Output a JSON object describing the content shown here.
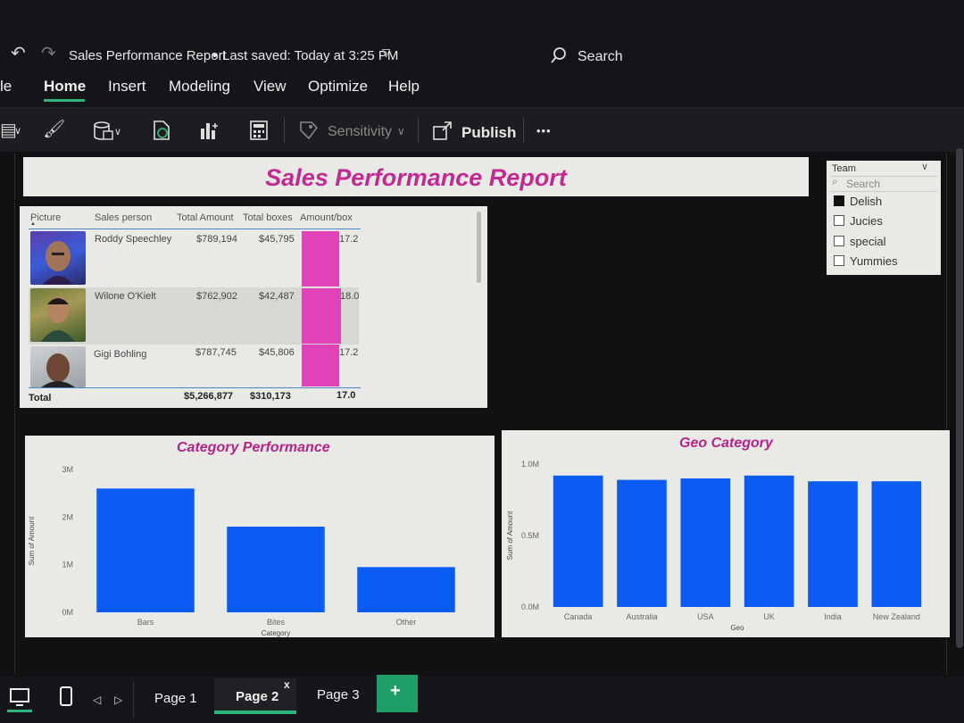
{
  "titlebar": {
    "doc_title": "Sales Performance Report",
    "saved_status": "Last saved: Today at 3:25 PM",
    "search_label": "Search",
    "edge_label": "le"
  },
  "ribbon": {
    "tabs": [
      "Home",
      "Insert",
      "Modeling",
      "View",
      "Optimize",
      "Help"
    ],
    "active_tab": "Home"
  },
  "toolbar": {
    "sensitivity_label": "Sensitivity",
    "publish_label": "Publish",
    "more_label": "•••"
  },
  "report": {
    "title": "Sales Performance Report"
  },
  "slicer": {
    "title": "Team",
    "search_placeholder": "Search",
    "items": [
      {
        "label": "Delish",
        "checked": true
      },
      {
        "label": "Jucies",
        "checked": false
      },
      {
        "label": "special",
        "checked": false
      },
      {
        "label": "Yummies",
        "checked": false
      }
    ]
  },
  "table": {
    "headers": [
      "Picture",
      "Sales person",
      "Total Amount",
      "Total boxes",
      "Amount/box"
    ],
    "rows": [
      {
        "name": "Roddy Speechley",
        "amount": "$789,194",
        "boxes": "$45,795",
        "per_box": "17.2"
      },
      {
        "name": "Wilone O'Kielt",
        "amount": "$762,902",
        "boxes": "$42,487",
        "per_box": "18.0"
      },
      {
        "name": "Gigi Bohling",
        "amount": "$787,745",
        "boxes": "$45,806",
        "per_box": "17.2"
      }
    ],
    "total": {
      "label": "Total",
      "amount": "$5,266,877",
      "boxes": "$310,173",
      "per_box": "17.0"
    },
    "bar_color": "#df43b7"
  },
  "chart_data": [
    {
      "type": "bar",
      "title": "Category Performance",
      "xlabel": "Category",
      "ylabel": "Sum of Amount",
      "categories": [
        "Bars",
        "Bites",
        "Other"
      ],
      "values": [
        2600000,
        1800000,
        950000
      ],
      "ylim": [
        0,
        3000000
      ],
      "yticks": [
        "0M",
        "1M",
        "2M",
        "3M"
      ],
      "color": "#0a5cf5"
    },
    {
      "type": "bar",
      "title": "Geo Category",
      "xlabel": "Geo",
      "ylabel": "Sum of Amount",
      "categories": [
        "Canada",
        "Australia",
        "USA",
        "UK",
        "India",
        "New Zealand"
      ],
      "values": [
        920000,
        890000,
        900000,
        920000,
        880000,
        880000
      ],
      "ylim": [
        0,
        1000000
      ],
      "yticks": [
        "0.0M",
        "0.5M",
        "1.0M"
      ],
      "color": "#0a5cf5"
    }
  ],
  "pages": {
    "tabs": [
      "Page 1",
      "Page 2",
      "Page 3"
    ],
    "active": "Page 2",
    "add_label": "+",
    "close_label": "x"
  }
}
